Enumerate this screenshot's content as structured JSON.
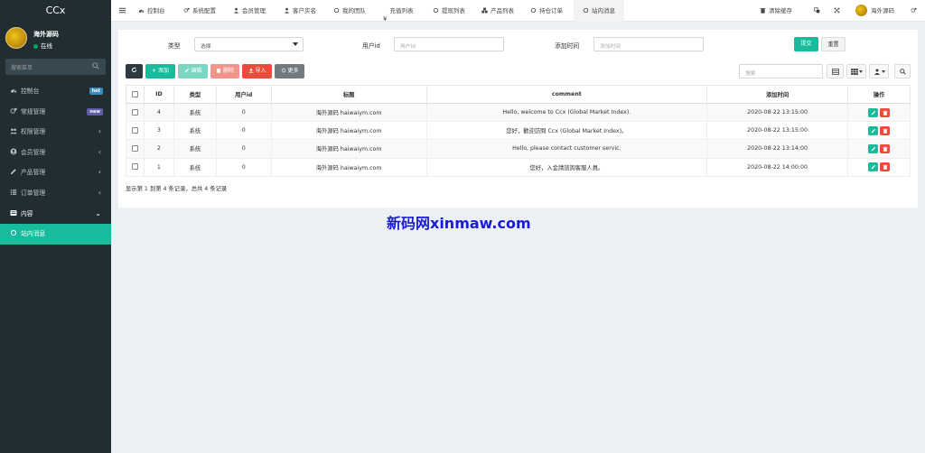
{
  "app": {
    "logo": "CCx"
  },
  "user": {
    "name": "海外源码",
    "status": "在线"
  },
  "sidebar": {
    "search_placeholder": "搜索菜单",
    "items": [
      {
        "label": "控制台",
        "icon": "dashboard-icon",
        "badge": "hot",
        "badge_color": "#3c8dbc"
      },
      {
        "label": "常规管理",
        "icon": "cogs-icon",
        "badge": "new",
        "badge_color": "#605ca8"
      },
      {
        "label": "权限管理",
        "icon": "group-icon",
        "chevron": "‹"
      },
      {
        "label": "会员管理",
        "icon": "user-circle-icon",
        "chevron": "‹"
      },
      {
        "label": "产品管理",
        "icon": "pencil-icon",
        "chevron": "‹"
      },
      {
        "label": "订单管理",
        "icon": "list-icon",
        "chevron": "‹"
      },
      {
        "label": "内容",
        "icon": "list-alt-icon",
        "chevron": "⌄"
      },
      {
        "label": "站内消息",
        "icon": "circle-icon"
      }
    ]
  },
  "topnav": {
    "tabs": [
      {
        "label": "控制台",
        "icon": "dashboard-icon"
      },
      {
        "label": "系统配置",
        "icon": "cogs-icon"
      },
      {
        "label": "会员管理",
        "icon": "user-icon"
      },
      {
        "label": "客户实名",
        "icon": "user-icon"
      },
      {
        "label": "我的团队",
        "icon": "circle-icon"
      },
      {
        "label": "充值列表",
        "icon": "yen-icon"
      },
      {
        "label": "提现列表",
        "icon": "circle-icon"
      },
      {
        "label": "产品列表",
        "icon": "cubes-icon"
      },
      {
        "label": "持仓订单",
        "icon": "circle-icon"
      },
      {
        "label": "站内消息",
        "icon": "circle-icon"
      }
    ],
    "clear_cache": "清除缓存",
    "user_name": "海外源码"
  },
  "filter": {
    "type_label": "类型",
    "type_value": "选择",
    "userid_label": "用户id",
    "userid_placeholder": "用户id",
    "time_label": "添加时间",
    "time_placeholder": "添加时间",
    "submit": "提交",
    "reset": "重置"
  },
  "toolbar": {
    "add": "添加",
    "edit": "编辑",
    "delete": "删除",
    "import": "导入",
    "more": "更多",
    "search_placeholder": "搜索"
  },
  "table": {
    "headers": [
      "ID",
      "类型",
      "用户id",
      "标题",
      "comment",
      "添加时间",
      "操作"
    ],
    "rows": [
      {
        "id": "4",
        "type": "系统",
        "userid": "0",
        "title": "海外源码 haiwaiym.com",
        "comment": "Hello, welcome to Ccx (Global Market Index).",
        "time": "2020-08-22 13:15:00"
      },
      {
        "id": "3",
        "type": "系统",
        "userid": "0",
        "title": "海外源码 haiwaiym.com",
        "comment": "您好，歡迎訪問 Ccx (Global Market Index)。",
        "time": "2020-08-22 13:15:00"
      },
      {
        "id": "2",
        "type": "系统",
        "userid": "0",
        "title": "海外源码 haiwaiym.com",
        "comment": "Hello, please contact customer servic.",
        "time": "2020-08-22 13:14:00"
      },
      {
        "id": "1",
        "type": "系统",
        "userid": "0",
        "title": "海外源码 haiwaiym.com",
        "comment": "您好，入金請諮詢客服人員。",
        "time": "2020-08-22 14:00:00"
      }
    ]
  },
  "pagination_info": "显示第 1 到第 4 条记录，总共 4 条记录",
  "watermark": "新码网xinmaw.com",
  "colors": {
    "sidebar": "#222d32",
    "accent": "#18bc9c",
    "danger": "#e74c3c",
    "dark": "#2c3b41"
  }
}
